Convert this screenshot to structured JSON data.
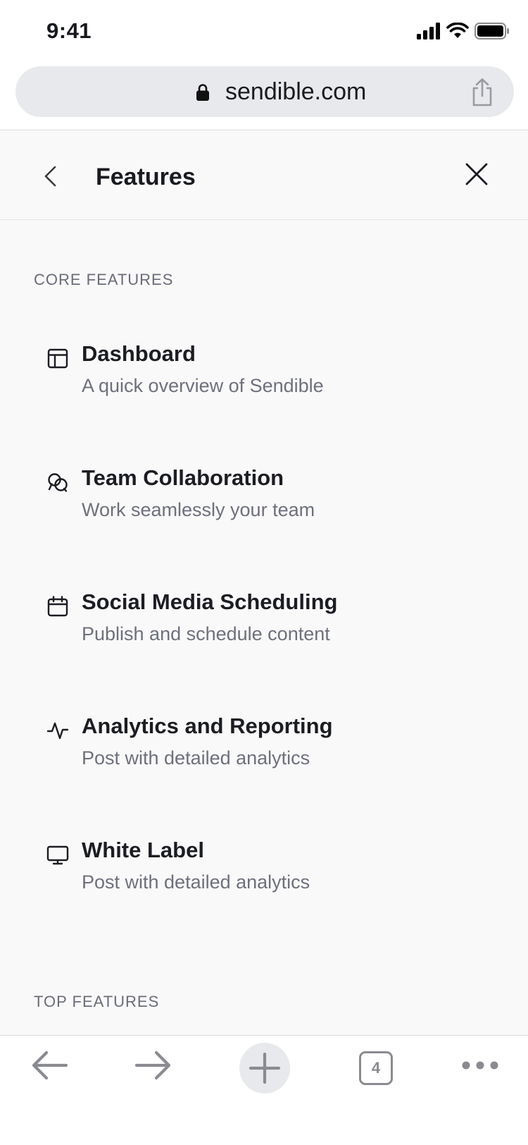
{
  "status_bar": {
    "time": "9:41"
  },
  "browser": {
    "url": "sendible.com",
    "tab_count": "4"
  },
  "nav": {
    "title": "Features"
  },
  "sections": [
    {
      "label": "CORE FEATURES",
      "items": [
        {
          "icon": "dashboard-icon",
          "title": "Dashboard",
          "description": "A quick overview of Sendible"
        },
        {
          "icon": "team-collaboration-icon",
          "title": "Team Collaboration",
          "description": "Work seamlessly your team"
        },
        {
          "icon": "calendar-icon",
          "title": "Social Media Scheduling",
          "description": "Publish and schedule content"
        },
        {
          "icon": "activity-icon",
          "title": "Analytics and Reporting",
          "description": "Post with detailed analytics"
        },
        {
          "icon": "monitor-icon",
          "title": "White Label",
          "description": "Post with detailed analytics"
        }
      ]
    },
    {
      "label": "TOP FEATURES",
      "items": []
    }
  ],
  "colors": {
    "panel_bg": "#f9f9fa",
    "title_text": "#1c1d22",
    "muted_text": "#6e707c",
    "toolbar_icon": "#8a8b90"
  }
}
